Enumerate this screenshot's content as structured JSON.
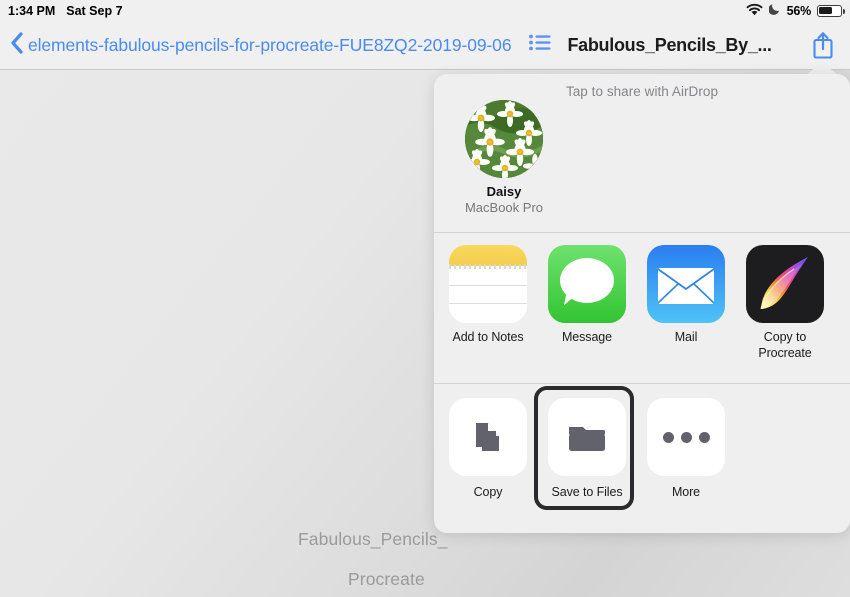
{
  "status_bar": {
    "time": "1:34 PM",
    "date": "Sat Sep 7",
    "wifi_icon": "wifi-icon",
    "dnd_icon": "moon-icon",
    "battery_percent": "56%",
    "battery_level": 56
  },
  "nav_bar": {
    "back_icon": "chevron-left-icon",
    "back_title": "elements-fabulous-pencils-for-procreate-FUE8ZQ2-2019-09-06",
    "list_icon": "list-bullet-icon",
    "document_title": "Fabulous_Pencils_By_...",
    "share_icon": "share-icon"
  },
  "document": {
    "line1": "Fabulous_Pencils_",
    "line2": "Procreate "
  },
  "share_sheet": {
    "airdrop": {
      "hint": "Tap to share with AirDrop",
      "targets": [
        {
          "name": "Daisy",
          "device": "MacBook Pro",
          "avatar_icon": "daisy-photo-avatar"
        }
      ]
    },
    "apps": [
      {
        "label": "Add to Notes",
        "icon": "notes-icon"
      },
      {
        "label": "Message",
        "icon": "messages-icon"
      },
      {
        "label": "Mail",
        "icon": "mail-icon"
      },
      {
        "label": "Copy to\nProcreate",
        "label_line1": "Copy to",
        "label_line2": "Procreate",
        "icon": "procreate-icon"
      }
    ],
    "actions": [
      {
        "label": "Copy",
        "icon": "copy-icon",
        "focused": false
      },
      {
        "label": "Save to Files",
        "icon": "folder-icon",
        "focused": true
      },
      {
        "label": "More",
        "icon": "ellipsis-icon",
        "focused": false
      }
    ]
  },
  "colors": {
    "accent_blue": "#4a8bf0",
    "sheet_bg": "#efeff0",
    "status_text": "#000000",
    "focus_ring": "#2b2b2e",
    "notes_yellow": "#f3cd4d",
    "messages_green": "#33c432",
    "mail_blue": "#2a7df0",
    "procreate_dark": "#1d1d1f"
  }
}
